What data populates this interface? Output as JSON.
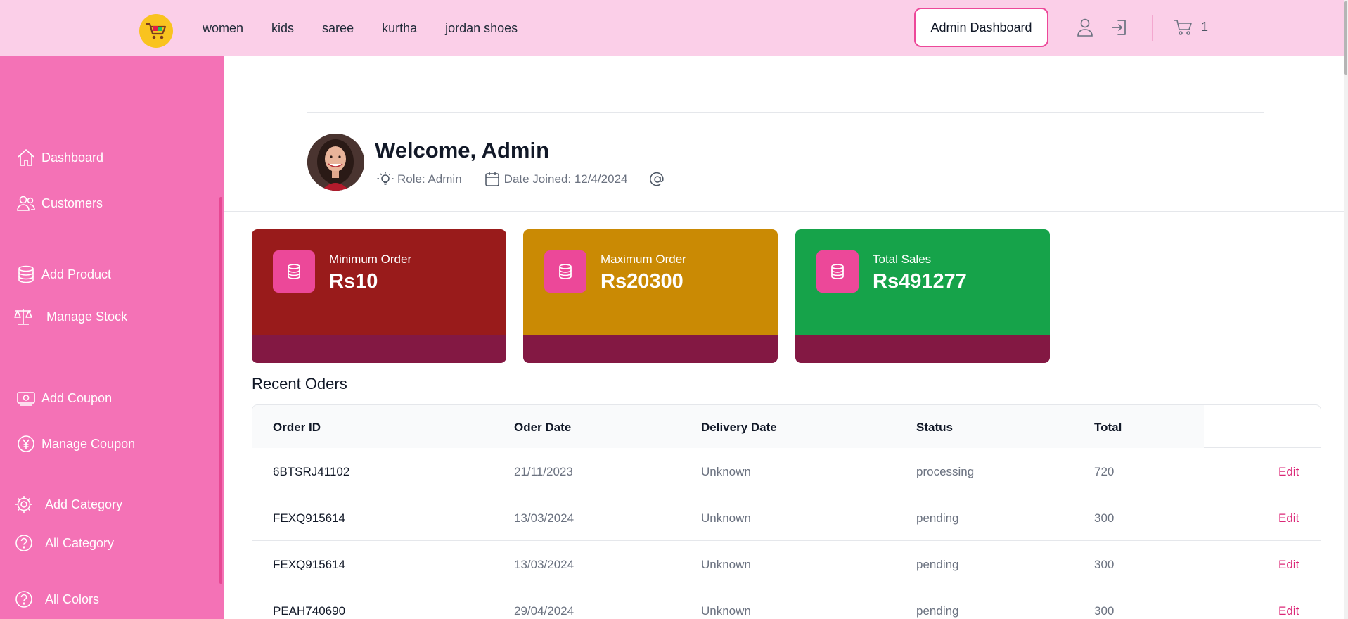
{
  "nav": {
    "links": [
      "women",
      "kids",
      "saree",
      "kurtha",
      "jordan shoes"
    ],
    "admin_button": "Admin Dashboard",
    "cart_count": "1"
  },
  "sidebar": {
    "items": [
      {
        "label": "Dashboard",
        "icon": "home-icon"
      },
      {
        "label": "Customers",
        "icon": "users-icon"
      },
      {
        "label": "Add Product",
        "icon": "database-icon"
      },
      {
        "label": "Manage Stock",
        "icon": "scale-icon"
      },
      {
        "label": "Add Coupon",
        "icon": "money-icon"
      },
      {
        "label": "Manage Coupon",
        "icon": "yen-icon"
      },
      {
        "label": "Add Category",
        "icon": "gear-icon"
      },
      {
        "label": "All Category",
        "icon": "question-icon"
      },
      {
        "label": "All Colors",
        "icon": "question-icon"
      }
    ]
  },
  "profile": {
    "welcome": "Welcome, Admin",
    "role": "Role: Admin",
    "date_joined": "Date Joined: 12/4/2024"
  },
  "cards": [
    {
      "label": "Minimum Order",
      "value": "Rs10",
      "color": "#991b1b"
    },
    {
      "label": "Maximum Order",
      "value": "Rs20300",
      "color": "#ca8a04"
    },
    {
      "label": "Total Sales",
      "value": "Rs491277",
      "color": "#16a34a"
    }
  ],
  "orders": {
    "title": "Recent Oders",
    "headers": [
      "Order ID",
      "Oder Date",
      "Delivery Date",
      "Status",
      "Total"
    ],
    "edit_label": "Edit",
    "rows": [
      [
        "6BTSRJ41102",
        "21/11/2023",
        "Unknown",
        "processing",
        "720"
      ],
      [
        "FEXQ915614",
        "13/03/2024",
        "Unknown",
        "pending",
        "300"
      ],
      [
        "FEXQ915614",
        "13/03/2024",
        "Unknown",
        "pending",
        "300"
      ],
      [
        "PEAH740690",
        "29/04/2024",
        "Unknown",
        "pending",
        "300"
      ]
    ]
  },
  "colors": {
    "topbar": "#fbcfe8",
    "sidebar": "#f472b6",
    "accent": "#ec4899",
    "card_footer": "#831843"
  }
}
